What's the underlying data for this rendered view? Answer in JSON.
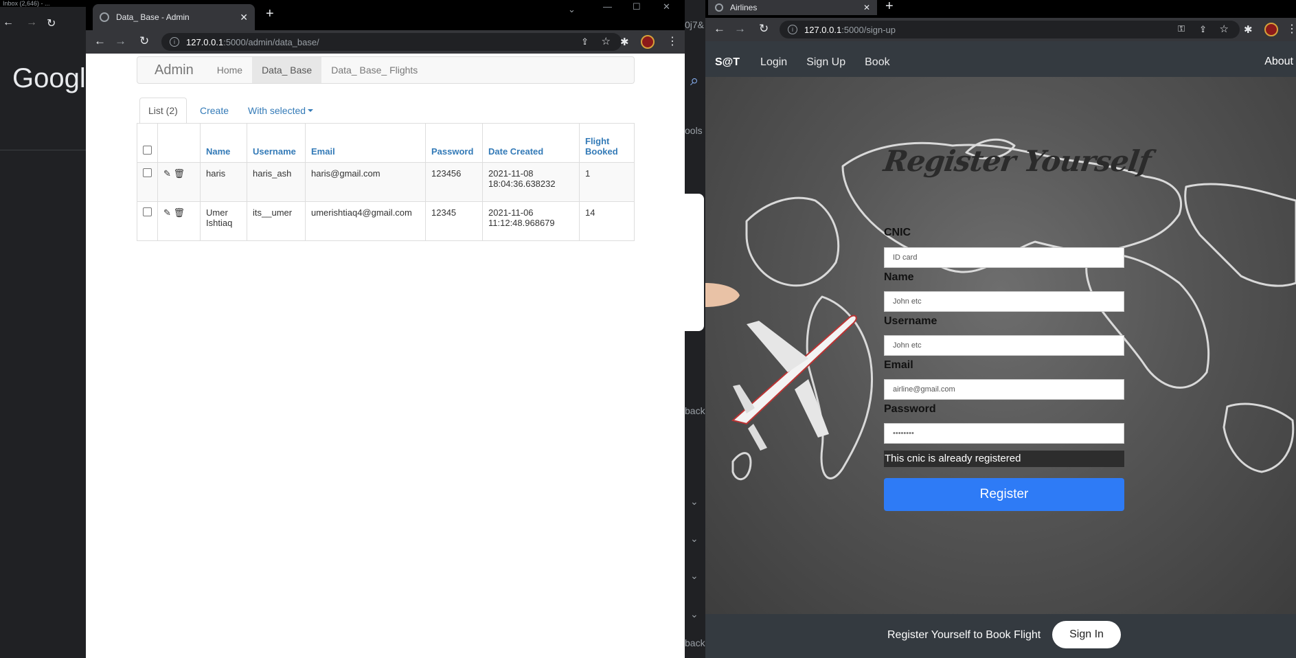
{
  "background_window": {
    "tab_text": "Inbox (2,646) - ...",
    "logo_text": "Google"
  },
  "admin_window": {
    "tab_title": "Data_ Base - Admin",
    "url_host": "127.0.0.1",
    "url_path": ":5000/admin/data_base/",
    "nav": {
      "brand": "Admin",
      "links": [
        "Home",
        "Data_ Base",
        "Data_ Base_ Flights"
      ]
    },
    "tabs": {
      "list": "List (2)",
      "create": "Create",
      "with_selected": "With selected"
    },
    "table": {
      "headers": [
        "Name",
        "Username",
        "Email",
        "Password",
        "Date Created",
        "Flight Booked"
      ],
      "rows": [
        {
          "name": "haris",
          "username": "haris_ash",
          "email": "haris@gmail.com",
          "password": "123456",
          "date_created": "2021-11-08 18:04:36.638232",
          "flight_booked": "1"
        },
        {
          "name": "Umer Ishtiaq",
          "username": "its__umer",
          "email": "umerishtiaq4@gmail.com",
          "password": "12345",
          "date_created": "2021-11-06 11:12:48.968679",
          "flight_booked": "14"
        }
      ]
    }
  },
  "middle_strip": {
    "texts": [
      "0j7&",
      "ools",
      "back",
      "back"
    ]
  },
  "airlines_window": {
    "tab_title": "Airlines",
    "url_host": "127.0.0.1",
    "url_path": ":5000/sign-up",
    "nav": {
      "brand": "S@T",
      "links": [
        "Login",
        "Sign Up",
        "Book"
      ],
      "about": "About"
    },
    "form": {
      "title": "Register Yourself",
      "cnic_label": "CNIC",
      "cnic_placeholder": "ID card",
      "name_label": "Name",
      "name_placeholder": "John etc",
      "username_label": "Username",
      "username_placeholder": "John etc",
      "email_label": "Email",
      "email_placeholder": "airline@gmail.com",
      "password_label": "Password",
      "password_value": "••••••••",
      "error": "This cnic is already registered",
      "register_button": "Register"
    },
    "footer": {
      "text": "Register Yourself to Book Flight",
      "signin_button": "Sign In"
    }
  },
  "colors": {
    "link_blue": "#337ab7",
    "register_button": "#2e7bf6",
    "chrome_dark": "#35363a"
  }
}
